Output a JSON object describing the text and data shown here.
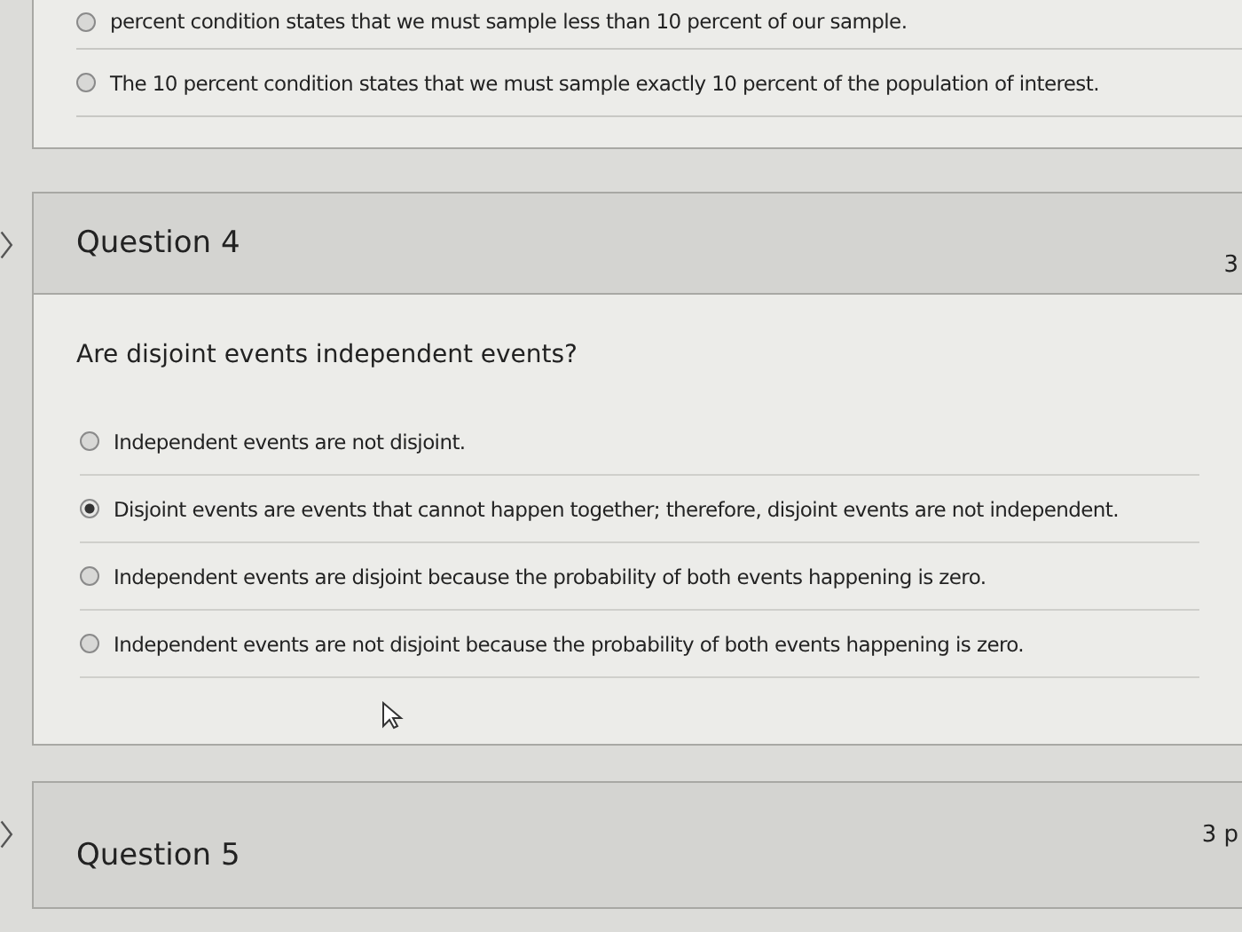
{
  "previous_question": {
    "options": [
      {
        "text": "percent condition states that we must sample less than 10 percent of our sample.",
        "selected": false
      },
      {
        "text": "The 10 percent condition states that we must sample exactly 10 percent of the population of interest.",
        "selected": false
      }
    ]
  },
  "question": {
    "title": "Question 4",
    "points": "3",
    "prompt": "Are disjoint events independent events?",
    "options": [
      {
        "text": "Independent events are not disjoint.",
        "selected": false
      },
      {
        "text": "Disjoint events are events that cannot happen together; therefore, disjoint events are not independent.",
        "selected": true
      },
      {
        "text": "Independent events are disjoint because the probability of both events happening is zero.",
        "selected": false
      },
      {
        "text": "Independent events are not disjoint because the probability of both events happening is zero.",
        "selected": false
      }
    ]
  },
  "next_question": {
    "title": "Question 5",
    "points": "3 p"
  }
}
